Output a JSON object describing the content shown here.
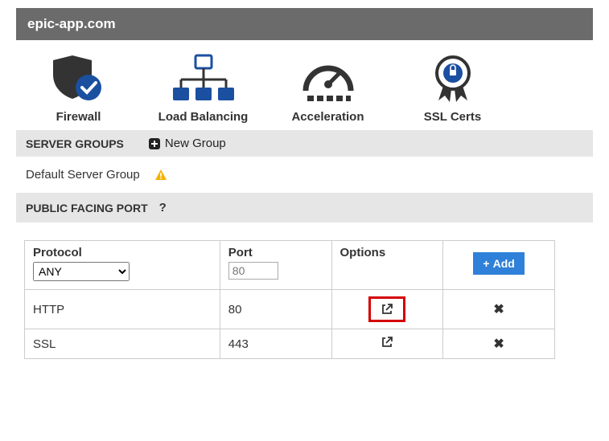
{
  "header": {
    "domain": "epic-app.com"
  },
  "nav": [
    {
      "label": "Firewall"
    },
    {
      "label": "Load Balancing"
    },
    {
      "label": "Acceleration"
    },
    {
      "label": "SSL Certs"
    }
  ],
  "server_groups": {
    "title": "SERVER GROUPS",
    "new_group": "New Group",
    "default": "Default Server Group"
  },
  "ports": {
    "title": "PUBLIC FACING PORT",
    "help": "?",
    "cols": {
      "protocol": "Protocol",
      "port": "Port",
      "options": "Options"
    },
    "protocol_select": "ANY",
    "port_placeholder": "80",
    "add": "Add",
    "rows": [
      {
        "protocol": "HTTP",
        "port": "80",
        "highlight": true
      },
      {
        "protocol": "SSL",
        "port": "443",
        "highlight": false
      }
    ]
  }
}
